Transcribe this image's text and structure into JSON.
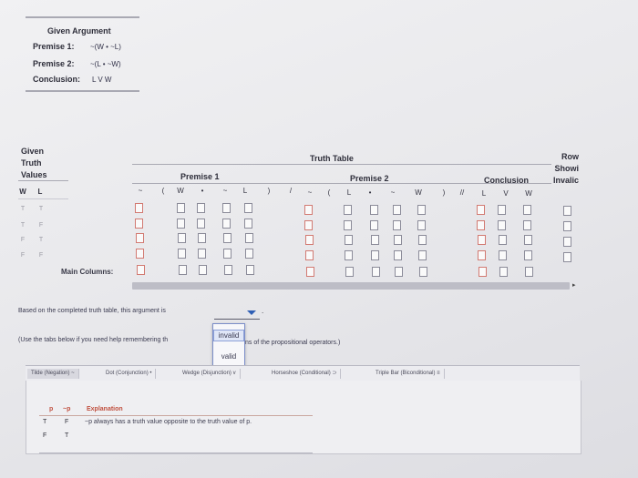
{
  "given_argument": {
    "title": "Given Argument",
    "premise1_label": "Premise 1:",
    "premise1_value": "~(W • ~L)",
    "premise2_label": "Premise 2:",
    "premise2_value": "~(L • ~W)",
    "conclusion_label": "Conclusion:",
    "conclusion_value": "L V W"
  },
  "truth_table": {
    "given_title_line1": "Given",
    "given_title_line2": "Truth",
    "given_title_line3": "Values",
    "title": "Truth Table",
    "row_header_line1": "Row",
    "row_header_line2": "Showi",
    "row_header_line3": "Invalic",
    "premise1_header": "Premise 1",
    "premise2_header": "Premise 2",
    "conclusion_header": "Conclusion",
    "var_headers": [
      "W",
      "L"
    ],
    "premise1_symbols": [
      "~",
      "(",
      "W",
      "•",
      "~",
      "L",
      ")"
    ],
    "sep1": "/",
    "premise2_symbols": [
      "~",
      "(",
      "L",
      "•",
      "~",
      "W",
      ")"
    ],
    "sep2": "//",
    "conclusion_symbols": [
      "L",
      "V",
      "W"
    ],
    "rows": [
      [
        "T",
        "T"
      ],
      [
        "T",
        "F"
      ],
      [
        "F",
        "T"
      ],
      [
        "F",
        "F"
      ]
    ],
    "main_columns_label": "Main Columns:"
  },
  "conclusion_text": {
    "prefix": "Based on the completed truth table, this argument is",
    "period": ".",
    "hint_prefix": "(Use the tabs below if you need help remembering th",
    "hint_suffix": "ns of the propositional operators.)"
  },
  "dropdown": {
    "selected": "",
    "options": [
      "invalid",
      "valid"
    ],
    "highlighted": "invalid"
  },
  "tabs": [
    {
      "label": "Tilde (Negation)",
      "icon": "~"
    },
    {
      "label": "Dot (Conjunction)",
      "icon": "•"
    },
    {
      "label": "Wedge (Disjunction)",
      "icon": "v"
    },
    {
      "label": "Horseshoe (Conditional)",
      "icon": "⊃"
    },
    {
      "label": "Triple Bar (Biconditional)",
      "icon": "≡"
    }
  ],
  "tab_panel": {
    "headers": [
      "p",
      "~p",
      "Explanation"
    ],
    "explanation": "~p always has a truth value opposite to the truth value of p.",
    "rows": [
      [
        "T",
        "F"
      ],
      [
        "F",
        "T"
      ]
    ]
  },
  "colors": {
    "accent_blue": "#2f5fb5",
    "cell_border_red": "#d27a72",
    "cell_border": "#8b8b99"
  }
}
